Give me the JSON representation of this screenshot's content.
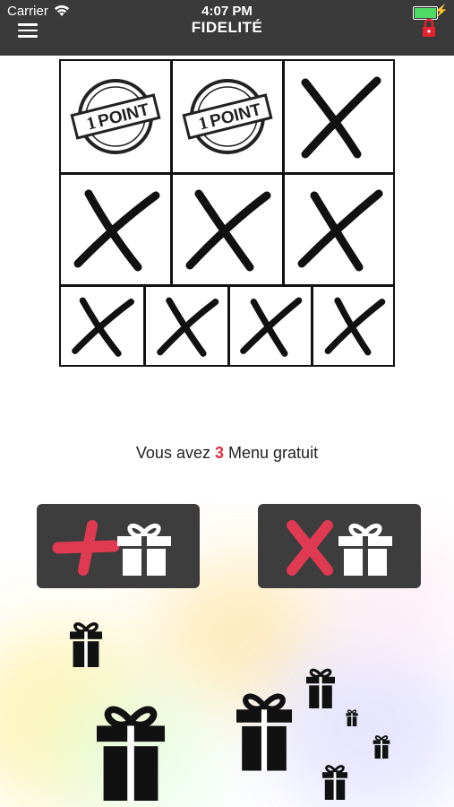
{
  "status": {
    "carrier": "Carrier",
    "time": "4:07 PM"
  },
  "header": {
    "title": "FIDELITÉ"
  },
  "stamp": {
    "text": "POINT",
    "number": "1"
  },
  "card": {
    "top_row": [
      "stamp",
      "stamp",
      "cross"
    ],
    "middle_row": [
      "cross",
      "cross",
      "cross"
    ],
    "bottom_row": [
      "cross",
      "cross",
      "cross",
      "cross"
    ]
  },
  "message": {
    "prefix": "Vous avez",
    "count": "3",
    "suffix": "Menu gratuit"
  },
  "colors": {
    "header": "#3a3a3a",
    "accent": "#e03040",
    "button": "#3d3d3d",
    "battery": "#4cd964"
  }
}
